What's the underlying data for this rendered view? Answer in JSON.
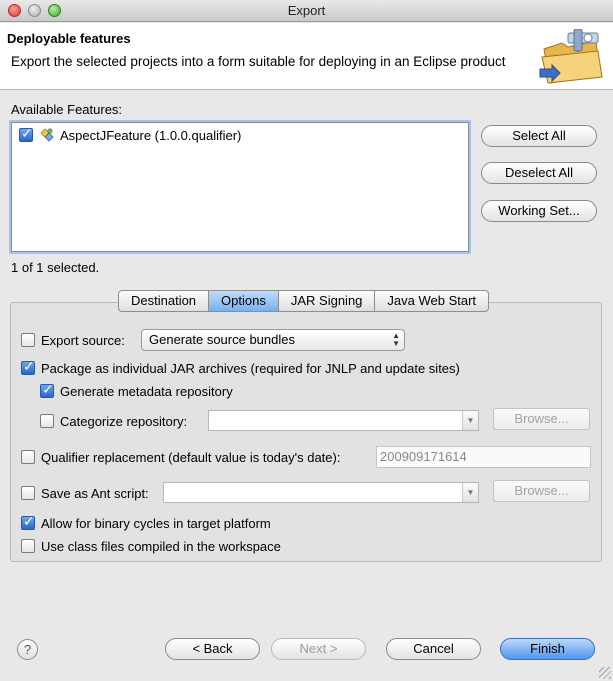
{
  "window": {
    "title": "Export"
  },
  "header": {
    "title": "Deployable features",
    "description": "Export the selected projects into a form suitable for deploying in an Eclipse product",
    "icon": "export-folder-icon"
  },
  "features": {
    "label": "Available Features:",
    "items": [
      {
        "label": "AspectJFeature (1.0.0.qualifier)",
        "checked": true,
        "icon": "feature-plugin-icon"
      }
    ],
    "selected_count": "1 of 1 selected.",
    "buttons": {
      "select_all": "Select All",
      "deselect_all": "Deselect All",
      "working_set": "Working Set..."
    }
  },
  "tabs": [
    {
      "label": "Destination",
      "active": false
    },
    {
      "label": "Options",
      "active": true
    },
    {
      "label": "JAR Signing",
      "active": false
    },
    {
      "label": "Java Web Start",
      "active": false
    }
  ],
  "options": {
    "export_source": {
      "label": "Export source:",
      "checked": false,
      "select_value": "Generate source bundles"
    },
    "package_jar": {
      "label": "Package as individual JAR archives (required for JNLP and update sites)",
      "checked": true
    },
    "generate_metadata": {
      "label": "Generate metadata repository",
      "checked": true
    },
    "categorize": {
      "label": "Categorize repository:",
      "checked": false,
      "value": "",
      "browse_label": "Browse..."
    },
    "qualifier": {
      "label": "Qualifier replacement (default value is today's date):",
      "checked": false,
      "value": "200909171614"
    },
    "ant_script": {
      "label": "Save as Ant script:",
      "checked": false,
      "value": "",
      "browse_label": "Browse..."
    },
    "binary_cycles": {
      "label": "Allow for binary cycles in target platform",
      "checked": true
    },
    "class_files": {
      "label": "Use class files compiled in the workspace",
      "checked": false
    }
  },
  "footer": {
    "help": "?",
    "back": "< Back",
    "next": "Next >",
    "cancel": "Cancel",
    "finish": "Finish"
  },
  "colors": {
    "accent": "#4f95ec",
    "checkbox_checked": "#2a67c8",
    "close": "#d9392f",
    "maximize": "#3da32b"
  }
}
